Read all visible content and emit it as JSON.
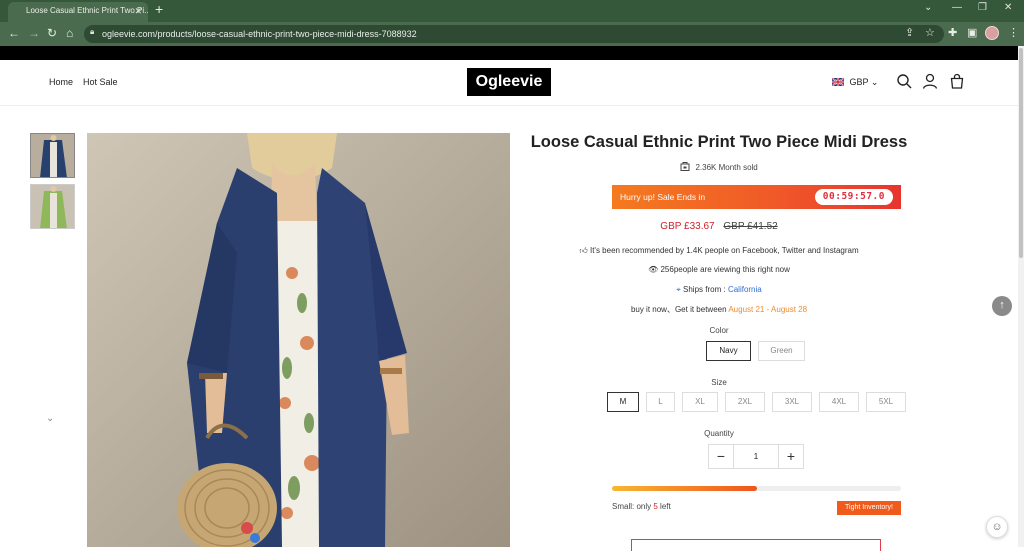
{
  "browser": {
    "tab_title": "Loose Casual Ethnic Print Two Pi...",
    "tab_close": "✕",
    "new_tab": "+",
    "url": "ogleevie.com/products/loose-casual-ethnic-print-two-piece-midi-dress-7088932"
  },
  "header": {
    "nav": [
      {
        "label": "Home"
      },
      {
        "label": "Hot Sale"
      }
    ],
    "logo": "Ogleevie",
    "currency": "GBP"
  },
  "product": {
    "title": "Loose Casual Ethnic Print Two Piece Midi Dress",
    "sold": "2.36K Month sold",
    "sale_text": "Hurry up! Sale Ends in",
    "timer": "00:59:57.0",
    "price_now": "GBP £33.67",
    "price_was": "GBP £41.52",
    "recommended": "It's been recommended by 1.4K people on Facebook, Twitter and Instagram",
    "viewing": "256people are viewing this right now",
    "ships_from_label": "Ships from :",
    "ships_from_value": "California",
    "delivery_prefix": "buy it now、Get it between",
    "delivery_start": "August 21",
    "delivery_sep": " - ",
    "delivery_end": "August 28",
    "color_label": "Color",
    "colors": [
      {
        "label": "Navy",
        "selected": true
      },
      {
        "label": "Green",
        "selected": false
      }
    ],
    "size_label": "Size",
    "sizes": [
      {
        "label": "M",
        "selected": true
      },
      {
        "label": "L",
        "selected": false
      },
      {
        "label": "XL",
        "selected": false
      },
      {
        "label": "2XL",
        "selected": false
      },
      {
        "label": "3XL",
        "selected": false
      },
      {
        "label": "4XL",
        "selected": false
      },
      {
        "label": "5XL",
        "selected": false
      }
    ],
    "quantity_label": "Quantity",
    "quantity": "1",
    "qty_minus": "−",
    "qty_plus": "+",
    "stock_prefix": "Small: only ",
    "stock_count": "5",
    "stock_suffix": " left",
    "stock_level": 0.5,
    "tight_inventory": "Tight Inventory!"
  },
  "colors": {
    "sale_red": "#d0212b",
    "accent_orange": "#f05a1a",
    "link_blue": "#2f6fd8",
    "browser_green": "#35573a"
  },
  "icons": [
    "back-icon",
    "forward-icon",
    "reload-icon",
    "home-icon",
    "lock-icon",
    "share-icon",
    "star-icon",
    "extensions-icon",
    "sidebar-icon",
    "menu-icon",
    "search-icon",
    "account-icon",
    "bag-icon",
    "shop-icon",
    "thumb-up-icon",
    "eye-icon",
    "location-icon",
    "chevron-down-icon",
    "arrow-up-icon",
    "help-icon"
  ]
}
